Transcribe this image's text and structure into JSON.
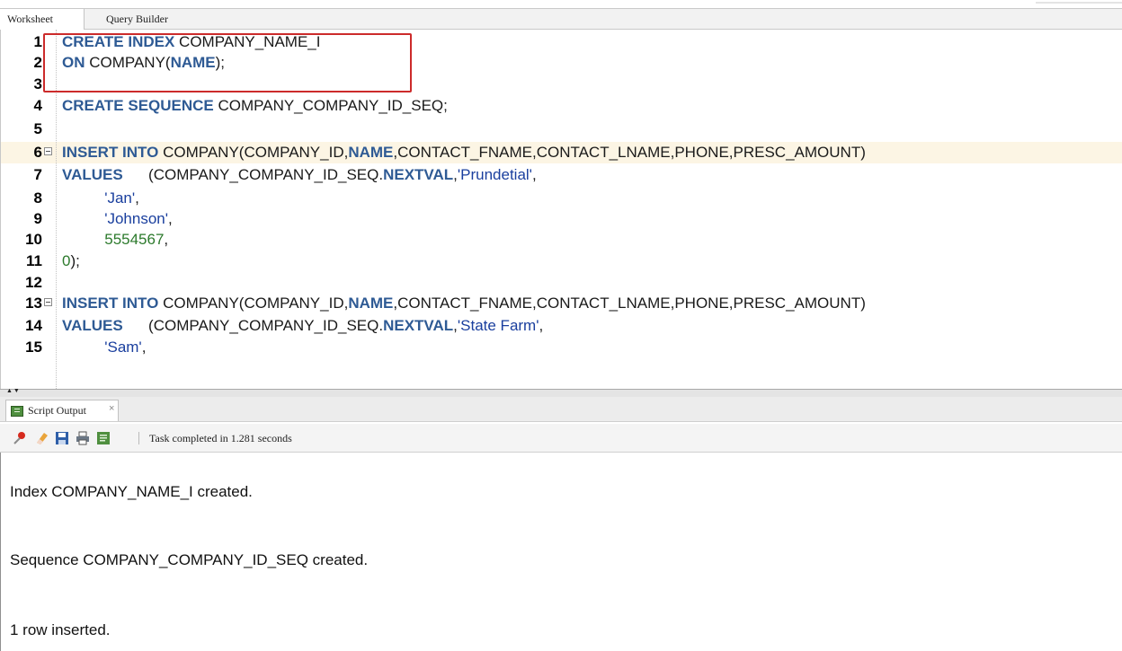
{
  "tabs": [
    "Worksheet",
    "Query Builder"
  ],
  "editor": {
    "lines": [
      {
        "n": "1",
        "fold": false,
        "hl": false,
        "segs": [
          [
            "kw",
            "CREATE INDEX"
          ],
          [
            "t",
            " COMPANY_NAME_I"
          ]
        ]
      },
      {
        "n": "2",
        "fold": false,
        "hl": false,
        "segs": [
          [
            "kw",
            "ON"
          ],
          [
            "t",
            " COMPANY("
          ],
          [
            "kw",
            "NAME"
          ],
          [
            "t",
            ");"
          ]
        ]
      },
      {
        "n": "3",
        "fold": false,
        "hl": false,
        "segs": []
      },
      {
        "n": "4",
        "fold": false,
        "hl": false,
        "segs": [
          [
            "kw",
            "CREATE SEQUENCE"
          ],
          [
            "t",
            " COMPANY_COMPANY_ID_SEQ;"
          ]
        ]
      },
      {
        "n": "5",
        "fold": false,
        "hl": false,
        "segs": []
      },
      {
        "n": "6",
        "fold": true,
        "hl": true,
        "segs": [
          [
            "kw",
            "INSERT INTO"
          ],
          [
            "t",
            " COMPANY(COMPANY_ID,"
          ],
          [
            "kw",
            "NAME"
          ],
          [
            "t",
            ",CONTACT_FNAME,CONTACT_LNAME,PHONE,PRESC_AMOUNT)"
          ]
        ]
      },
      {
        "n": "7",
        "fold": false,
        "hl": false,
        "segs": [
          [
            "kw",
            "VALUES"
          ],
          [
            "t",
            "      (COMPANY_COMPANY_ID_SEQ."
          ],
          [
            "kw",
            "NEXTVAL"
          ],
          [
            "t",
            ","
          ],
          [
            "str",
            "'Prundetial'"
          ],
          [
            "t",
            ","
          ]
        ]
      },
      {
        "n": "8",
        "fold": false,
        "hl": false,
        "segs": [
          [
            "t",
            "          "
          ],
          [
            "str",
            "'Jan'"
          ],
          [
            "t",
            ","
          ]
        ]
      },
      {
        "n": "9",
        "fold": false,
        "hl": false,
        "segs": [
          [
            "t",
            "          "
          ],
          [
            "str",
            "'Johnson'"
          ],
          [
            "t",
            ","
          ]
        ]
      },
      {
        "n": "10",
        "fold": false,
        "hl": false,
        "segs": [
          [
            "t",
            "          "
          ],
          [
            "num",
            "5554567"
          ],
          [
            "t",
            ","
          ]
        ]
      },
      {
        "n": "11",
        "fold": false,
        "hl": false,
        "segs": [
          [
            "num",
            "0"
          ],
          [
            "t",
            ");"
          ]
        ]
      },
      {
        "n": "12",
        "fold": false,
        "hl": false,
        "segs": []
      },
      {
        "n": "13",
        "fold": true,
        "hl": false,
        "segs": [
          [
            "kw",
            "INSERT INTO"
          ],
          [
            "t",
            " COMPANY(COMPANY_ID,"
          ],
          [
            "kw",
            "NAME"
          ],
          [
            "t",
            ",CONTACT_FNAME,CONTACT_LNAME,PHONE,PRESC_AMOUNT)"
          ]
        ]
      },
      {
        "n": "14",
        "fold": false,
        "hl": false,
        "segs": [
          [
            "kw",
            "VALUES"
          ],
          [
            "t",
            "      (COMPANY_COMPANY_ID_SEQ."
          ],
          [
            "kw",
            "NEXTVAL"
          ],
          [
            "t",
            ","
          ],
          [
            "str",
            "'State Farm'"
          ],
          [
            "t",
            ","
          ]
        ]
      },
      {
        "n": "15",
        "fold": false,
        "hl": false,
        "segs": [
          [
            "t",
            "          "
          ],
          [
            "str",
            "'Sam'"
          ],
          [
            "t",
            ","
          ]
        ]
      }
    ]
  },
  "output_panel": {
    "tab_label": "Script Output",
    "close_glyph": "×",
    "status": "Task completed in 1.281 seconds",
    "toolbar_icons": [
      "pin-icon",
      "eraser-icon",
      "save-icon",
      "print-icon",
      "save-output-icon"
    ],
    "lines": [
      "Index COMPANY_NAME_I created.",
      "Sequence COMPANY_COMPANY_ID_SEQ created.",
      "1 row inserted."
    ]
  },
  "colors": {
    "keyword": "#2e5a94",
    "string": "#1a3f9e",
    "number": "#2c7a2c",
    "highlight_box": "#cc2b2b",
    "current_line": "#fcf5e4"
  }
}
